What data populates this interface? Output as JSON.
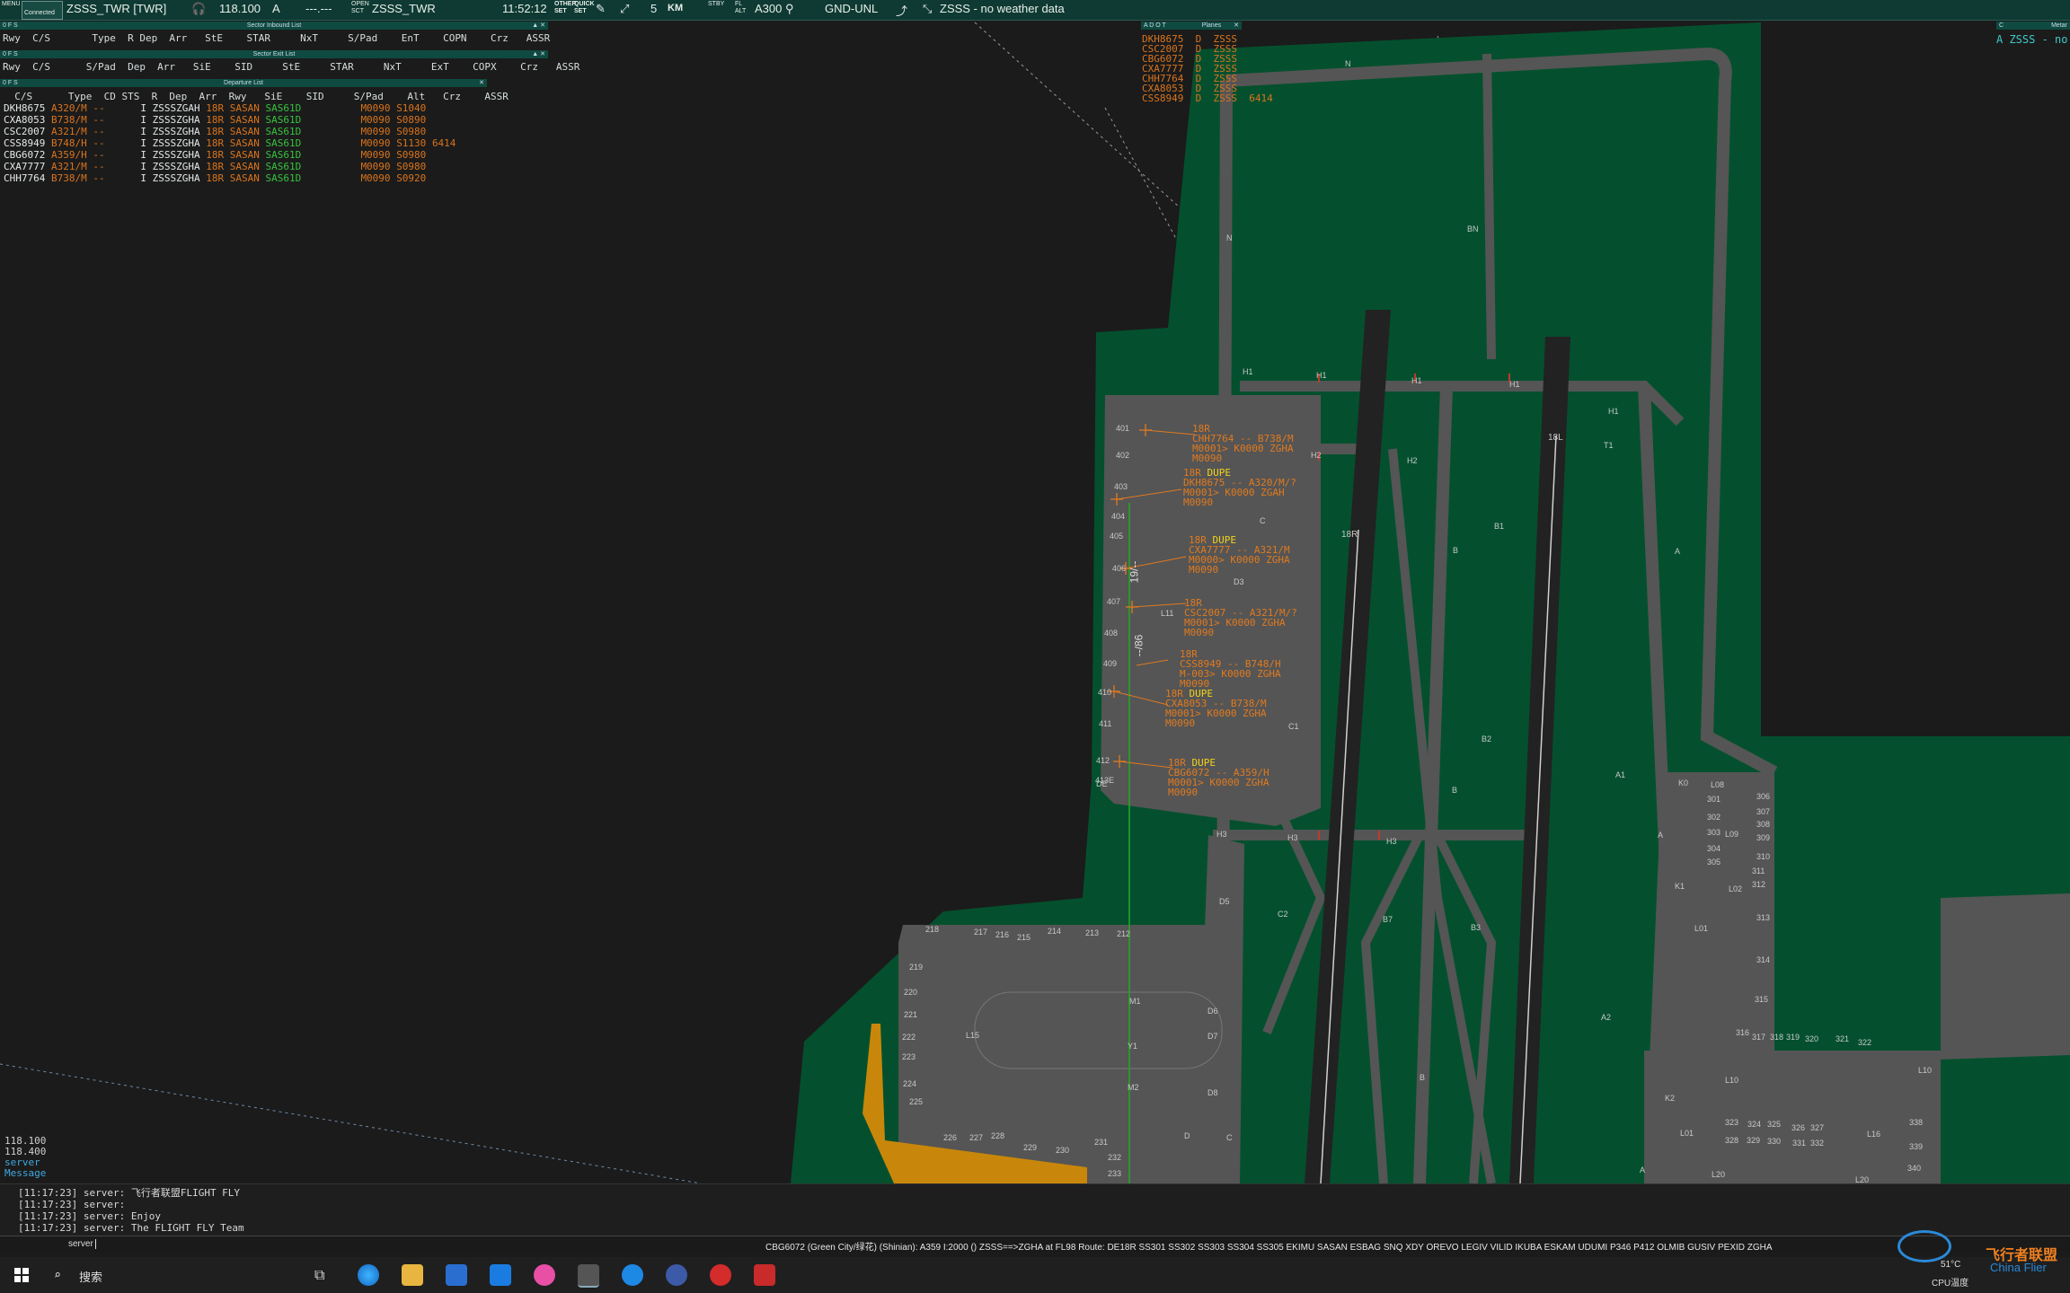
{
  "topbar": {
    "menu": "MENU",
    "connect": "Connected",
    "callsign": "ZSSS_TWR [TWR]",
    "freq": "118.100",
    "atis": "A",
    "dashes": "---.---",
    "open_label": "OPEN\nSCT",
    "open_pos": "ZSSS_TWR",
    "time": "11:52:12",
    "other_set": "OTHER\nSET",
    "quick_set": "QUICK\nSET",
    "range": "5",
    "range_unit": "KM",
    "stby": "STBY",
    "fl_alt": "FL\nALT",
    "aircraft": "A300",
    "level": "GND-UNL",
    "weather": "ZSSS - no weather data"
  },
  "inbound": {
    "title": "Sector Inbound List",
    "headers": "Rwy  C/S       Type  R Dep  Arr   StE    STAR     NxT     S/Pad    EnT    COPN    Crz   ASSR"
  },
  "exit": {
    "title": "Sector Exit List",
    "headers": "Rwy  C/S      S/Pad  Dep  Arr   SiE    SID     StE     STAR     NxT     ExT    COPX    Crz   ASSR"
  },
  "departure": {
    "title": "Departure List",
    "headers": "  C/S      Type  CD STS  R  Dep  Arr  Rwy   SiE    SID     S/Pad    Alt   Crz    ASSR",
    "rows": [
      {
        "cs": "DKH8675",
        "type": "A320/M",
        "cd": "--",
        "r": "I",
        "dep": "ZSSS",
        "arr": "ZGAH",
        "rwy": "18R",
        "sie": "SASAN",
        "sid": "SAS61D",
        "alt": "M0090",
        "crz": "S1040",
        "assr": ""
      },
      {
        "cs": "CXA8053",
        "type": "B738/M",
        "cd": "--",
        "r": "I",
        "dep": "ZSSS",
        "arr": "ZGHA",
        "rwy": "18R",
        "sie": "SASAN",
        "sid": "SAS61D",
        "alt": "M0090",
        "crz": "S0890",
        "assr": ""
      },
      {
        "cs": "CSC2007",
        "type": "A321/M",
        "cd": "--",
        "r": "I",
        "dep": "ZSSS",
        "arr": "ZGHA",
        "rwy": "18R",
        "sie": "SASAN",
        "sid": "SAS61D",
        "alt": "M0090",
        "crz": "S0980",
        "assr": ""
      },
      {
        "cs": "CSS8949",
        "type": "B748/H",
        "cd": "--",
        "r": "I",
        "dep": "ZSSS",
        "arr": "ZGHA",
        "rwy": "18R",
        "sie": "SASAN",
        "sid": "SAS61D",
        "alt": "M0090",
        "crz": "S1130",
        "assr": "6414"
      },
      {
        "cs": "CBG6072",
        "type": "A359/H",
        "cd": "--",
        "r": "I",
        "dep": "ZSSS",
        "arr": "ZGHA",
        "rwy": "18R",
        "sie": "SASAN",
        "sid": "SAS61D",
        "alt": "M0090",
        "crz": "S0980",
        "assr": ""
      },
      {
        "cs": "CXA7777",
        "type": "A321/M",
        "cd": "--",
        "r": "I",
        "dep": "ZSSS",
        "arr": "ZGHA",
        "rwy": "18R",
        "sie": "SASAN",
        "sid": "SAS61D",
        "alt": "M0090",
        "crz": "S0980",
        "assr": ""
      },
      {
        "cs": "CHH7764",
        "type": "B738/M",
        "cd": "--",
        "r": "I",
        "dep": "ZSSS",
        "arr": "ZGHA",
        "rwy": "18R",
        "sie": "SASAN",
        "sid": "SAS61D",
        "alt": "M0090",
        "crz": "S0920",
        "assr": ""
      }
    ]
  },
  "planes": {
    "title": "Planes",
    "cols": "A D O T",
    "rows": [
      "DKH8675  D  ZSSS",
      "CSC2007  D  ZSSS",
      "CBG6072  D  ZSSS",
      "CXA7777  D  ZSSS",
      "CHH7764  D  ZSSS",
      "CXA8053  D  ZSSS",
      "CSS8949  D  ZSSS  6414"
    ]
  },
  "metar": {
    "title": "Metar",
    "text": "A ZSSS - no"
  },
  "runways": {
    "left": "18R",
    "right": "18L"
  },
  "tags": [
    {
      "l1": "18R",
      "dupe": "",
      "l2": "CHH7764 -- B738/M",
      "l3": "M0001> K0000 ZGHA",
      "l4": "M0090"
    },
    {
      "l1": "18R",
      "dupe": "DUPE",
      "l2": "DKH8675 -- A320/M/?",
      "l3": "M0001> K0000 ZGAH",
      "l4": "M0090"
    },
    {
      "l1": "18R",
      "dupe": "DUPE",
      "l2": "CXA7777 -- A321/M",
      "l3": "M0000> K0000 ZGHA",
      "l4": "M0090"
    },
    {
      "l1": "18R",
      "dupe": "",
      "l2": "CSC2007 -- A321/M/?",
      "l3": "M0001> K0000 ZGHA",
      "l4": "M0090"
    },
    {
      "l1": "18R",
      "dupe": "",
      "l2": "CSS8949 -- B748/H",
      "l3": "M-003> K0000 ZGHA",
      "l4": "M0090"
    },
    {
      "l1": "18R",
      "dupe": "DUPE",
      "l2": "CXA8053 -- B738/M",
      "l3": "M0001> K0000 ZGHA",
      "l4": "M0090"
    },
    {
      "l1": "18R",
      "dupe": "DUPE",
      "l2": "CBG6072 -- A359/H",
      "l3": "M0001> K0000 ZGHA",
      "l4": "M0090"
    }
  ],
  "stands_left": [
    "401",
    "402",
    "403",
    "404",
    "405",
    "406",
    "407",
    "408",
    "409",
    "410",
    "411",
    "412",
    "413E"
  ],
  "stands_bottom": [
    "218",
    "217",
    "216",
    "215",
    "214",
    "213",
    "212",
    "219",
    "220",
    "221",
    "222",
    "223",
    "224",
    "225",
    "226",
    "227",
    "228",
    "229",
    "230",
    "231",
    "232",
    "233"
  ],
  "stands_right": [
    "301",
    "302",
    "303",
    "304",
    "305",
    "306",
    "307",
    "308",
    "309",
    "310",
    "311",
    "312",
    "313",
    "314",
    "315",
    "316",
    "317",
    "318",
    "319",
    "320",
    "321",
    "322",
    "323",
    "324",
    "325",
    "326",
    "327",
    "328",
    "329",
    "330",
    "331",
    "332",
    "338",
    "339",
    "340"
  ],
  "twy_labels": [
    "N",
    "N",
    "BN",
    "H1",
    "H1",
    "H1",
    "H1",
    "H1",
    "H2",
    "H2",
    "T1",
    "B1",
    "B",
    "B",
    "C",
    "D3",
    "L11",
    "C1",
    "B2",
    "A",
    "A1",
    "K0",
    "L08",
    "L09",
    "A",
    "K1",
    "L01",
    "L02",
    "H3",
    "H3",
    "H3",
    "D5",
    "C2",
    "B7",
    "B3",
    "M1",
    "D6",
    "D7",
    "D8",
    "M2",
    "L15",
    "Y1",
    "A2",
    "K2",
    "L01",
    "L10",
    "L10",
    "L16",
    "L20",
    "L20",
    "A",
    "B",
    "D",
    "C",
    "DE"
  ],
  "misc_labels": {
    "rw_text1": "19/--",
    "rw_text2": "--/86"
  },
  "freqs": [
    "118.100",
    "118.400"
  ],
  "freq_server": "server",
  "freq_msg": "Message",
  "messages": [
    "[11:17:23] server: 飞行者联盟FLIGHT FLY",
    "[11:17:23] server:",
    "[11:17:23] server: Enjoy",
    "[11:17:23] server: The FLIGHT FLY Team"
  ],
  "command": {
    "prefix": "server",
    "text": ""
  },
  "flightstrip": "CBG6072 (Green City/绿花) (Shinian): A359 I:2000 () ZSSS==>ZGHA at FL98 Route: DE18R SS301 SS302 SS303 SS304 SS305 EKIMU SASAN ESBAG SNQ XDY OREVO LEGIV VILID IKUBA ESKAM UDUMI P346 P412 OLMIB GUSIV PEXID ZGHA",
  "taskbar": {
    "search": "搜索",
    "temp": "51°C",
    "cpu": "CPU温度",
    "watermark": "飞行者联盟",
    "watermark2": "China Flier"
  },
  "colors": {
    "grass": "#04502e",
    "pavement": "#555555",
    "runway": "#222222",
    "tag": "#e07a1f",
    "dupe": "#f2d21d",
    "sid": "#37c23e",
    "panel": "#0f4a40"
  }
}
